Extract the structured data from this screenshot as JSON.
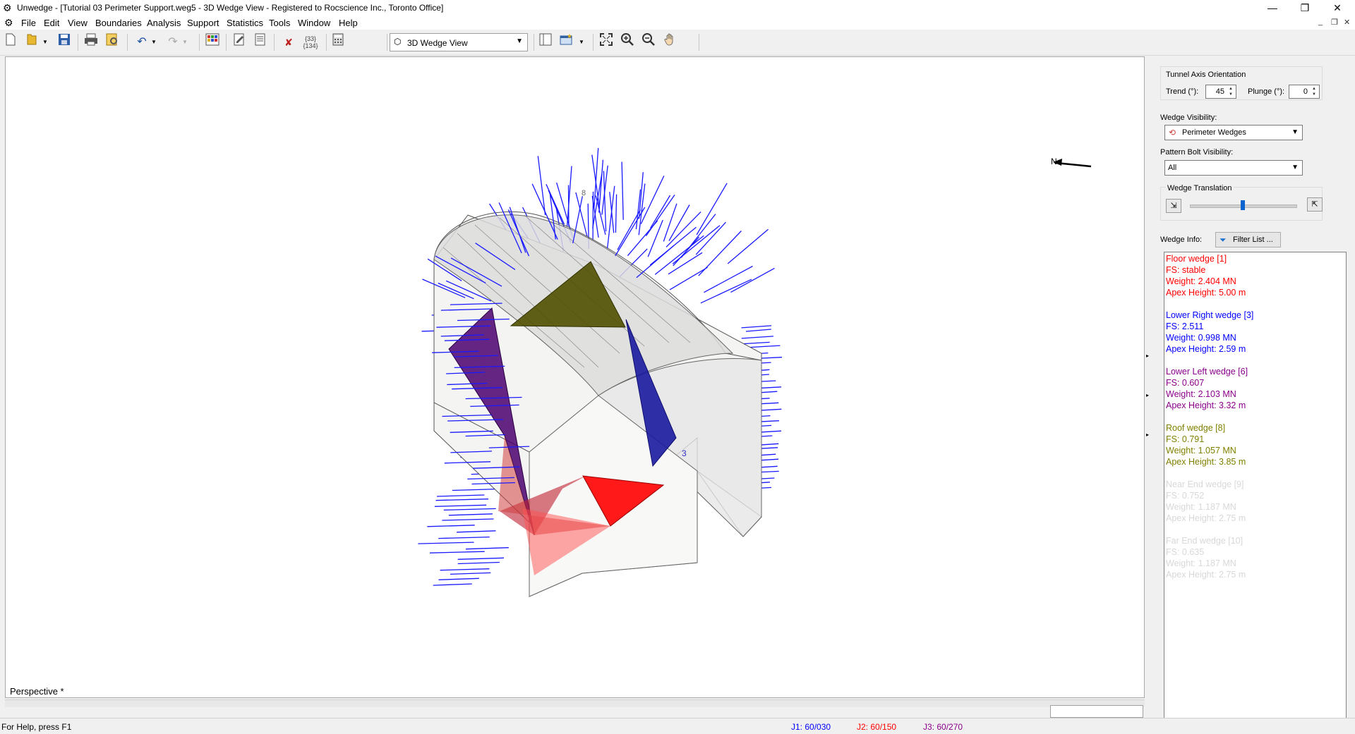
{
  "window": {
    "title": "Unwedge - [Tutorial 03 Perimeter Support.weg5 - 3D Wedge View - Registered to Rocscience Inc., Toronto Office]",
    "minimize": "—",
    "restore": "❐",
    "close": "✕"
  },
  "menu": {
    "items": [
      "File",
      "Edit",
      "View",
      "Boundaries",
      "Analysis",
      "Support",
      "Statistics",
      "Tools",
      "Window",
      "Help"
    ],
    "mdi_min": "_",
    "mdi_restore": "❐",
    "mdi_close": "✕"
  },
  "toolbar": {
    "view_select": "3D Wedge View",
    "icons": [
      "new-icon",
      "open-icon",
      "save-icon",
      "print-icon",
      "print-preview-icon",
      "undo-icon",
      "redo-icon",
      "input-data-icon",
      "edit-icon",
      "info-icon",
      "delete-icon",
      "numbers-icon",
      "calculator-icon",
      "layout-icon",
      "add-view-icon",
      "zoom-extents-icon",
      "zoom-in-icon",
      "zoom-out-icon",
      "pan-icon"
    ],
    "number_badge": "{33}\n{134}"
  },
  "viewport": {
    "projection_label": "Perspective *",
    "north_label": "N",
    "wedge_label": "3",
    "colors": {
      "bolts": "#1a1aff",
      "floor_wedge": "#ff0000",
      "lower_left_wedge": "#4a0070",
      "lower_right_wedge": "#1a1aa0",
      "roof_wedge": "#505000",
      "tunnel": "#d8d8d8"
    }
  },
  "panel": {
    "tunnel_axis": {
      "group_label": "Tunnel Axis Orientation",
      "trend_label": "Trend (°):",
      "trend_value": "45",
      "plunge_label": "Plunge (°):",
      "plunge_value": "0"
    },
    "wedge_visibility": {
      "label": "Wedge Visibility:",
      "value": "Perimeter Wedges"
    },
    "bolt_visibility": {
      "label": "Pattern Bolt Visibility:",
      "value": "All"
    },
    "translation": {
      "label": "Wedge Translation",
      "position": 0.5
    },
    "wedge_info": {
      "label": "Wedge Info:",
      "filter_button": "Filter List ..."
    },
    "wedges": [
      {
        "name": "Floor wedge [1]",
        "fs": "FS: stable",
        "weight": "Weight: 2.404 MN",
        "apex": "Apex Height: 5.00 m",
        "color": "#ff0000"
      },
      {
        "name": "Lower Right wedge [3]",
        "fs": "FS: 2.511",
        "weight": "Weight: 0.998 MN",
        "apex": "Apex Height: 2.59 m",
        "color": "#0000ff"
      },
      {
        "name": "Lower Left wedge [6]",
        "fs": "FS: 0.607",
        "weight": "Weight: 2.103 MN",
        "apex": "Apex Height: 3.32 m",
        "color": "#8b008b"
      },
      {
        "name": "Roof wedge [8]",
        "fs": "FS: 0.791",
        "weight": "Weight: 1.057 MN",
        "apex": "Apex Height: 3.85 m",
        "color": "#808000"
      },
      {
        "name": "Near End wedge [9]",
        "fs": "FS: 0.752",
        "weight": "Weight: 1.187 MN",
        "apex": "Apex Height: 2.75 m",
        "color": "#d8d8d8"
      },
      {
        "name": "Far End wedge [10]",
        "fs": "FS: 0.635",
        "weight": "Weight: 1.187 MN",
        "apex": "Apex Height: 2.75 m",
        "color": "#d8d8d8"
      }
    ]
  },
  "status": {
    "help": "For Help, press F1",
    "j1": "J1: 60/030",
    "j2": "J2: 60/150",
    "j3": "J3: 60/270",
    "j1_color": "#0000ff",
    "j2_color": "#ff0000",
    "j3_color": "#8b008b"
  }
}
